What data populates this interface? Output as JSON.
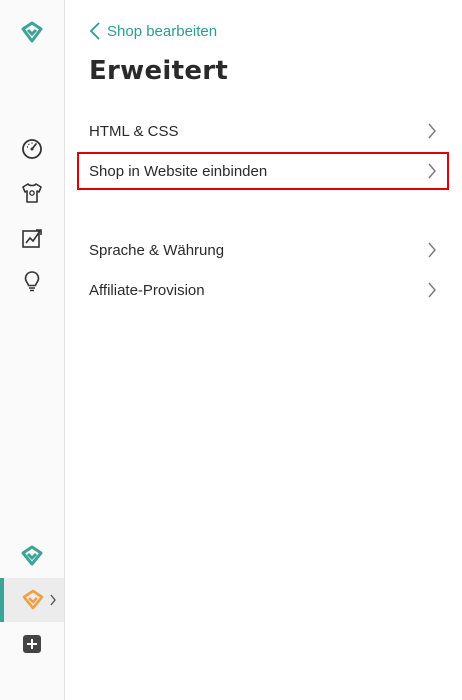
{
  "colors": {
    "accent": "#3aa597",
    "highlight": "#e00000",
    "brand_orange": "#f0a040"
  },
  "sidebar": {
    "icons": [
      "brand-logo-icon",
      "dashboard-gauge-icon",
      "tshirt-icon",
      "statistics-chart-icon",
      "lightbulb-icon",
      "shop-logo-icon",
      "shop-logo-orange-icon",
      "add-icon"
    ]
  },
  "header": {
    "back_label": "Shop bearbeiten",
    "title": "Erweitert"
  },
  "menu": [
    {
      "label": "HTML & CSS"
    },
    {
      "label": "Shop in Website einbinden"
    },
    {
      "label": "Sprache & Währung"
    },
    {
      "label": "Affiliate-Provision"
    }
  ]
}
